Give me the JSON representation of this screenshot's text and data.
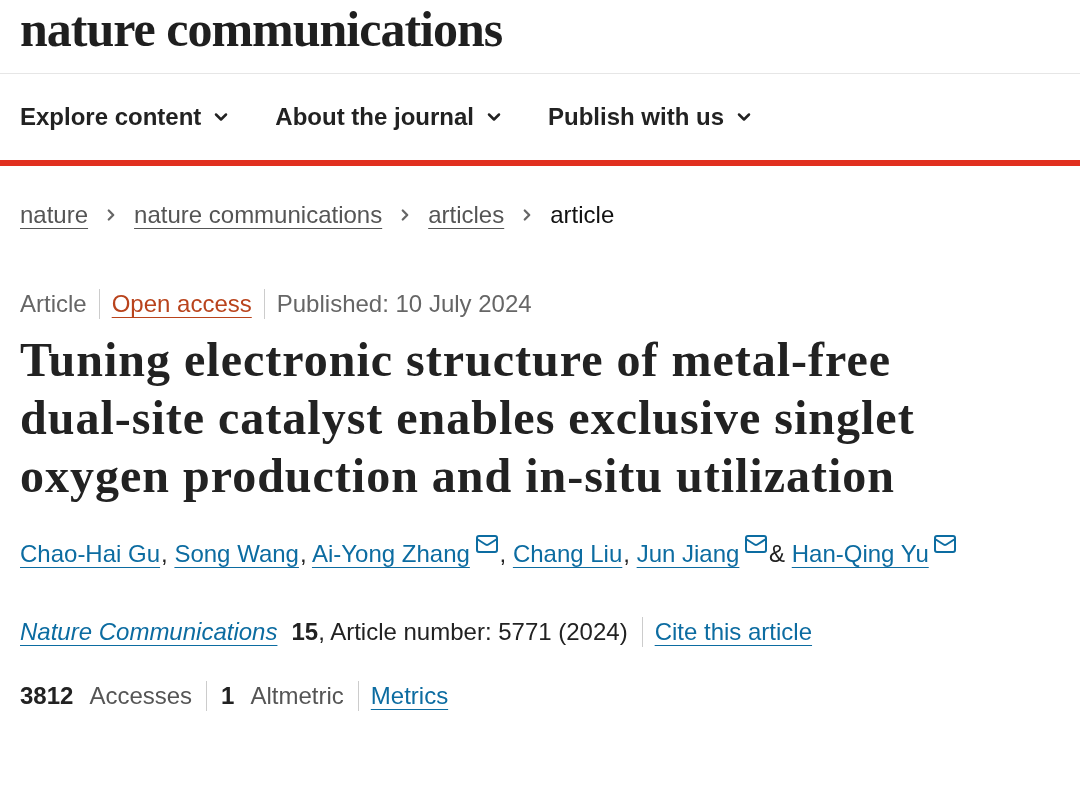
{
  "logo": "nature communications",
  "nav": [
    {
      "label": "Explore content"
    },
    {
      "label": "About the journal"
    },
    {
      "label": "Publish with us"
    }
  ],
  "breadcrumbs": [
    {
      "label": "nature",
      "current": false
    },
    {
      "label": "nature communications",
      "current": false
    },
    {
      "label": "articles",
      "current": false
    },
    {
      "label": "article",
      "current": true
    }
  ],
  "meta": {
    "type": "Article",
    "access": "Open access",
    "published": "Published: 10 July 2024"
  },
  "title": "Tuning electronic structure of metal-free dual-site catalyst enables exclusive singlet oxygen production and in-situ utilization",
  "authors": [
    {
      "name": "Chao-Hai Gu",
      "email": false,
      "sep": ","
    },
    {
      "name": "Song Wang",
      "email": false,
      "sep": ","
    },
    {
      "name": "Ai-Yong Zhang",
      "email": true,
      "sep": ","
    },
    {
      "name": "Chang Liu",
      "email": false,
      "sep": ","
    },
    {
      "name": "Jun Jiang",
      "email": true,
      "sep": "&"
    },
    {
      "name": "Han-Qing Yu",
      "email": true
    }
  ],
  "citation": {
    "journal": "Nature Communications",
    "details": "**15**, Article number: 5771 (2024)",
    "cite": "Cite this article"
  },
  "metrics": [
    {
      "count": "3812",
      "name": "Accesses"
    },
    {
      "count": "1",
      "name": "Altmetric"
    }
  ],
  "metrics_link": "Metrics"
}
